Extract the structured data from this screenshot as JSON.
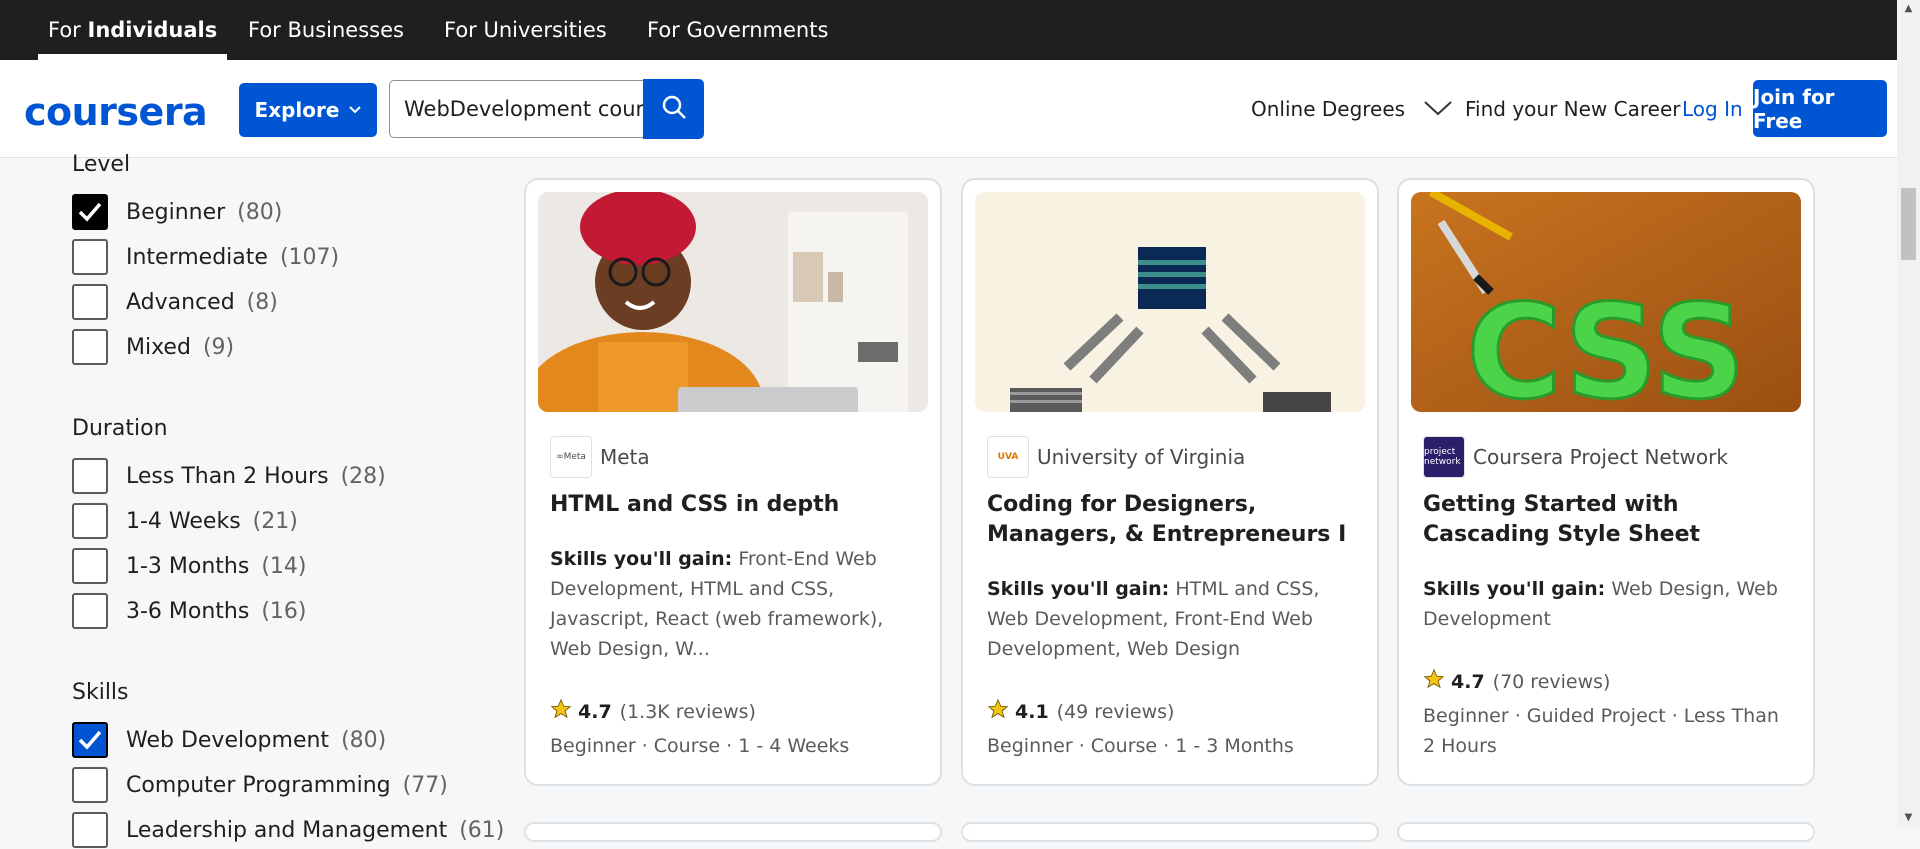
{
  "audience_tabs": [
    "For Individuals",
    "For Businesses",
    "For Universities",
    "For Governments"
  ],
  "active_tab_prefix": "For ",
  "active_tab_bold": "Individuals",
  "header": {
    "logo": "coursera",
    "explore_label": "Explore",
    "search_value": "WebDevelopment cour",
    "online_degrees": "Online Degrees",
    "find_career": "Find your New Career",
    "login": "Log In",
    "join": "Join for Free"
  },
  "filters": {
    "level": {
      "title": "Level",
      "options": [
        {
          "label": "Beginner",
          "count": "(80)",
          "checked": true
        },
        {
          "label": "Intermediate",
          "count": "(107)",
          "checked": false
        },
        {
          "label": "Advanced",
          "count": "(8)",
          "checked": false
        },
        {
          "label": "Mixed",
          "count": "(9)",
          "checked": false
        }
      ]
    },
    "duration": {
      "title": "Duration",
      "options": [
        {
          "label": "Less Than 2 Hours",
          "count": "(28)",
          "checked": false
        },
        {
          "label": "1-4 Weeks",
          "count": "(21)",
          "checked": false
        },
        {
          "label": "1-3 Months",
          "count": "(14)",
          "checked": false
        },
        {
          "label": "3-6 Months",
          "count": "(16)",
          "checked": false
        }
      ]
    },
    "skills": {
      "title": "Skills",
      "options": [
        {
          "label": "Web Development",
          "count": "(80)",
          "checked": true
        },
        {
          "label": "Computer Programming",
          "count": "(77)",
          "checked": false
        },
        {
          "label": "Leadership and Management",
          "count": "(61)",
          "checked": false
        }
      ]
    }
  },
  "cards": [
    {
      "partner": "Meta",
      "partner_logo": "∞Meta",
      "title": "HTML and CSS in depth",
      "skills_label": "Skills you'll gain:",
      "skills": "Front-End Web Development, HTML and CSS, Javascript, React (web framework), Web Design, W...",
      "rating": "4.7",
      "reviews": "(1.3K reviews)",
      "meta": "Beginner · Course · 1 - 4 Weeks"
    },
    {
      "partner": "University of Virginia",
      "partner_logo": "UVA",
      "title": "Coding for Designers, Managers, & Entrepreneurs I",
      "skills_label": "Skills you'll gain:",
      "skills": "HTML and CSS, Web Development, Front-End Web Development, Web Design",
      "rating": "4.1",
      "reviews": "(49 reviews)",
      "meta": "Beginner · Course · 1 - 3 Months"
    },
    {
      "partner": "Coursera Project Network",
      "partner_logo": "project network",
      "title": "Getting Started with Cascading Style Sheet",
      "skills_label": "Skills you'll gain:",
      "skills": "Web Design, Web Development",
      "rating": "4.7",
      "reviews": "(70 reviews)",
      "meta": "Beginner · Guided Project · Less Than 2 Hours",
      "image_text": "CSS"
    }
  ],
  "colors": {
    "brand": "#0056d2",
    "topbar": "#1f1f1f",
    "star": "#f5c518"
  }
}
